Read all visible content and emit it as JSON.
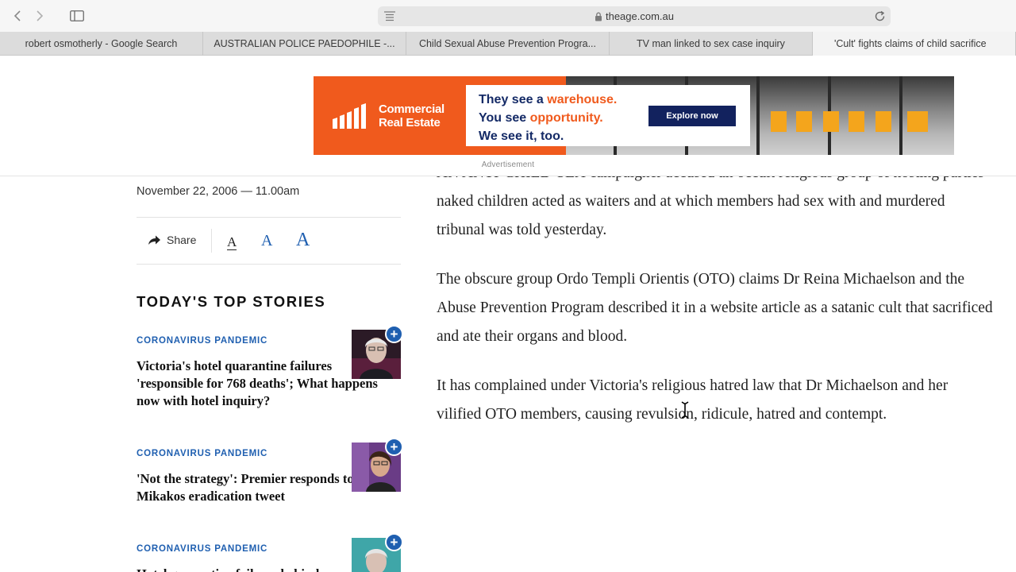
{
  "browser": {
    "url": "theage.com.au",
    "tabs": [
      {
        "label": "robert osmotherly - Google Search"
      },
      {
        "label": "AUSTRALIAN POLICE PAEDOPHILE -..."
      },
      {
        "label": "Child Sexual Abuse Prevention Progra..."
      },
      {
        "label": "TV man linked to sex case inquiry"
      },
      {
        "label": "'Cult' fights claims of child sacrifice"
      }
    ]
  },
  "ad": {
    "logo_line1": "Commercial",
    "logo_line2": "Real Estate",
    "line1_a": "They see a ",
    "line1_b": "warehouse.",
    "line2_a": "You see ",
    "line2_b": "opportunity.",
    "line3": "We see it, too.",
    "cta": "Explore now",
    "label": "Advertisement",
    "colors": {
      "brand_orange": "#f05a1d",
      "navy": "#12225e",
      "door_yellow": "#f4a51c"
    }
  },
  "article_meta": {
    "dateline": "November 22, 2006 — 11.00am",
    "share_label": "Share",
    "font_size_glyph": "A"
  },
  "sidebar": {
    "heading": "TODAY'S TOP STORIES",
    "stories": [
      {
        "kicker": "CORONAVIRUS PANDEMIC",
        "headline": "Victoria's hotel quarantine failures 'responsible for 768 deaths'; What happens now with hotel inquiry?"
      },
      {
        "kicker": "CORONAVIRUS PANDEMIC",
        "headline": "'Not the strategy': Premier responds to Mikakos eradication tweet"
      },
      {
        "kicker": "CORONAVIRUS PANDEMIC",
        "headline": "Hotel quarantine failures behind"
      }
    ]
  },
  "article": {
    "paragraphs": [
      {
        "lines": [
          "AN ANTI-CHILD-SEX campaigner accused an occult religious group of hosting parties",
          "naked children acted as waiters and at which members had sex with and murdered",
          "tribunal was told yesterday."
        ]
      },
      {
        "lines": [
          "The obscure group Ordo Templi Orientis (OTO) claims Dr Reina Michaelson and the",
          "Abuse Prevention Program described it in a website article as a satanic cult that sacrificed",
          "and ate their organs and blood."
        ]
      },
      {
        "lines": [
          "It has complained under Victoria's religious hatred law that Dr Michaelson and her",
          "vilified OTO members, causing revulsion, ridicule, hatred and contempt."
        ]
      }
    ]
  },
  "colors": {
    "link_blue": "#1f5fb0",
    "text": "#222222"
  }
}
